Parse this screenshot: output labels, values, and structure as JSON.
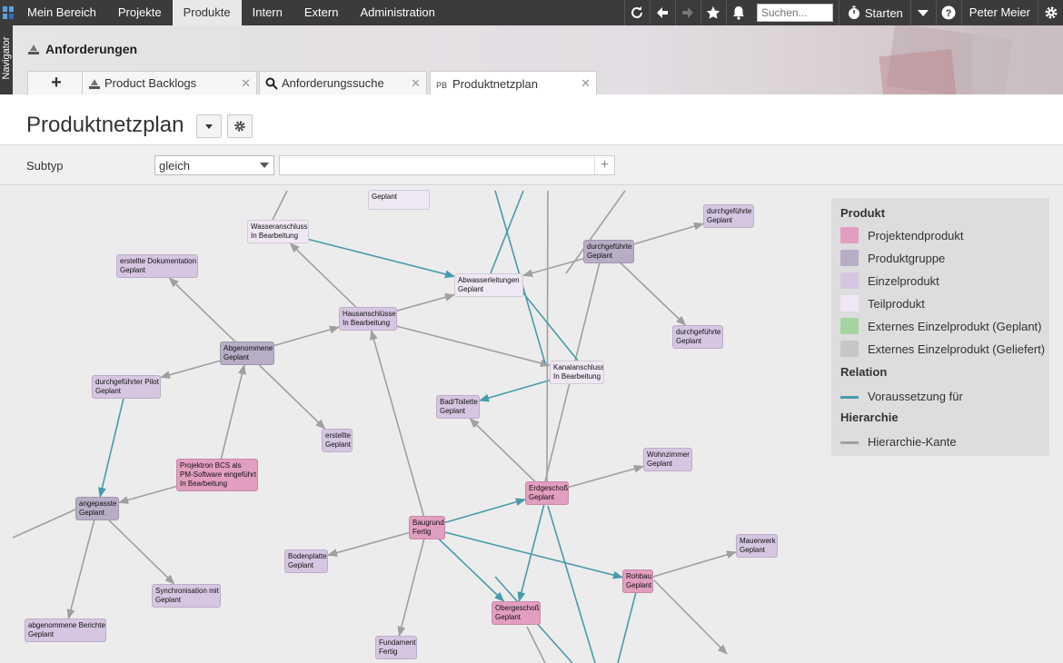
{
  "topbar": {
    "menu": [
      "Mein Bereich",
      "Projekte",
      "Produkte",
      "Intern",
      "Extern",
      "Administration"
    ],
    "active_menu": "Produkte",
    "search_placeholder": "Suchen...",
    "start_label": "Starten",
    "user_name": "Peter Meier",
    "icons": [
      "refresh-icon",
      "arrow-left-icon",
      "arrow-right-icon",
      "star-icon",
      "bell-icon",
      "timer-icon",
      "caret-down-icon",
      "help-icon",
      "gear-icon"
    ]
  },
  "navigator": {
    "label": "Navigator"
  },
  "section": {
    "title": "Anforderungen"
  },
  "tabs": [
    {
      "label": "+",
      "icon": "plus-icon"
    },
    {
      "label": "Product Backlogs",
      "icon": "backlog-icon"
    },
    {
      "label": "Anforderungssuche",
      "icon": "search-icon"
    },
    {
      "label": "Produktnetzplan",
      "icon": "netplan-icon"
    }
  ],
  "page": {
    "title": "Produktnetzplan"
  },
  "filter": {
    "label": "Subtyp",
    "select_value": "gleich",
    "input_value": "",
    "add_label": "+"
  },
  "colors": {
    "projektendprodukt": "#e29ec0",
    "produktgruppe": "#b7adc4",
    "einzelprodukt": "#d6c6e2",
    "teilprodukt": "#efe7f4",
    "extern_geplant": "#a7d3a3",
    "extern_geliefert": "#c6c6c6",
    "relation": "#4a9aab",
    "hierarchie": "#a0a0a0"
  },
  "legend": {
    "produkt_heading": "Produkt",
    "produkt_items": [
      {
        "label": "Projektendprodukt",
        "color": "#e29ec0"
      },
      {
        "label": "Produktgruppe",
        "color": "#b7adc4"
      },
      {
        "label": "Einzelprodukt",
        "color": "#d6c6e2"
      },
      {
        "label": "Teilprodukt",
        "color": "#efe7f4"
      },
      {
        "label": "Externes Einzelprodukt (Geplant)",
        "color": "#a7d3a3"
      },
      {
        "label": "Externes Einzelprodukt (Geliefert)",
        "color": "#c6c6c6"
      }
    ],
    "relation_heading": "Relation",
    "relation_item": "Voraussetzung für",
    "hierarchie_heading": "Hierarchie",
    "hierarchie_item": "Hierarchie-Kante"
  },
  "nodes": [
    {
      "id": "wasser",
      "line1": "Wasseranschluss",
      "line2": "In Bearbeitung",
      "kind": "teilprodukt"
    },
    {
      "id": "top1",
      "line1": "",
      "line2": "Geplant",
      "kind": "teilprodukt"
    },
    {
      "id": "erstdok",
      "line1": "erstellte Dokumentation",
      "line2": "Geplant",
      "kind": "einzelprodukt"
    },
    {
      "id": "dgf1",
      "line1": "durchgeführte",
      "line2": "Geplant",
      "kind": "einzelprodukt"
    },
    {
      "id": "dgf2",
      "line1": "durchgeführte",
      "line2": "Geplant",
      "kind": "produktgruppe"
    },
    {
      "id": "abwasser",
      "line1": "Abwasserleitungen",
      "line2": "Geplant",
      "kind": "teilprodukt"
    },
    {
      "id": "haus",
      "line1": "Hausanschlüsse",
      "line2": "In Bearbeitung",
      "kind": "einzelprodukt"
    },
    {
      "id": "abgen",
      "line1": "Abgenommene",
      "line2": "Geplant",
      "kind": "produktgruppe"
    },
    {
      "id": "dgf3",
      "line1": "durchgeführte",
      "line2": "Geplant",
      "kind": "einzelprodukt"
    },
    {
      "id": "kanal",
      "line1": "Kanalanschluss",
      "line2": "In Bearbeitung",
      "kind": "teilprodukt"
    },
    {
      "id": "pilot",
      "line1": "durchgeführter Pilot",
      "line2": "Geplant",
      "kind": "einzelprodukt"
    },
    {
      "id": "bad",
      "line1": "Bad/Toilette",
      "line2": "Geplant",
      "kind": "einzelprodukt"
    },
    {
      "id": "erstellte",
      "line1": "erstellte",
      "line2": "Geplant",
      "kind": "einzelprodukt"
    },
    {
      "id": "wohn",
      "line1": "Wohnzimmer",
      "line2": "Geplant",
      "kind": "einzelprodukt"
    },
    {
      "id": "projektron",
      "line1": "Projektron BCS als",
      "line2": "PM-Software eingeführt",
      "line3": "In Bearbeitung",
      "kind": "projektendprodukt"
    },
    {
      "id": "erdg",
      "line1": "Erdgeschoß",
      "line2": "Geplant",
      "kind": "projektendprodukt"
    },
    {
      "id": "angep",
      "line1": "angepasste",
      "line2": "Geplant",
      "kind": "produktgruppe"
    },
    {
      "id": "baugrund",
      "line1": "Baugrund",
      "line2": "Fertig",
      "kind": "projektendprodukt"
    },
    {
      "id": "mauer",
      "line1": "Mauerwerk",
      "line2": "Geplant",
      "kind": "einzelprodukt"
    },
    {
      "id": "boden",
      "line1": "Bodenplatte",
      "line2": "Geplant",
      "kind": "einzelprodukt"
    },
    {
      "id": "rohbau",
      "line1": "Rohbau",
      "line2": "Geplant",
      "kind": "projektendprodukt"
    },
    {
      "id": "sync",
      "line1": "Synchronisation mit",
      "line2": "Geplant",
      "kind": "einzelprodukt"
    },
    {
      "id": "oberg",
      "line1": "Obergeschoß",
      "line2": "Geplant",
      "kind": "projektendprodukt"
    },
    {
      "id": "berichte",
      "line1": "abgenommene Berichte",
      "line2": "Geplant",
      "kind": "einzelprodukt"
    },
    {
      "id": "fund",
      "line1": "Fundament",
      "line2": "Fertig",
      "kind": "einzelprodukt"
    }
  ]
}
